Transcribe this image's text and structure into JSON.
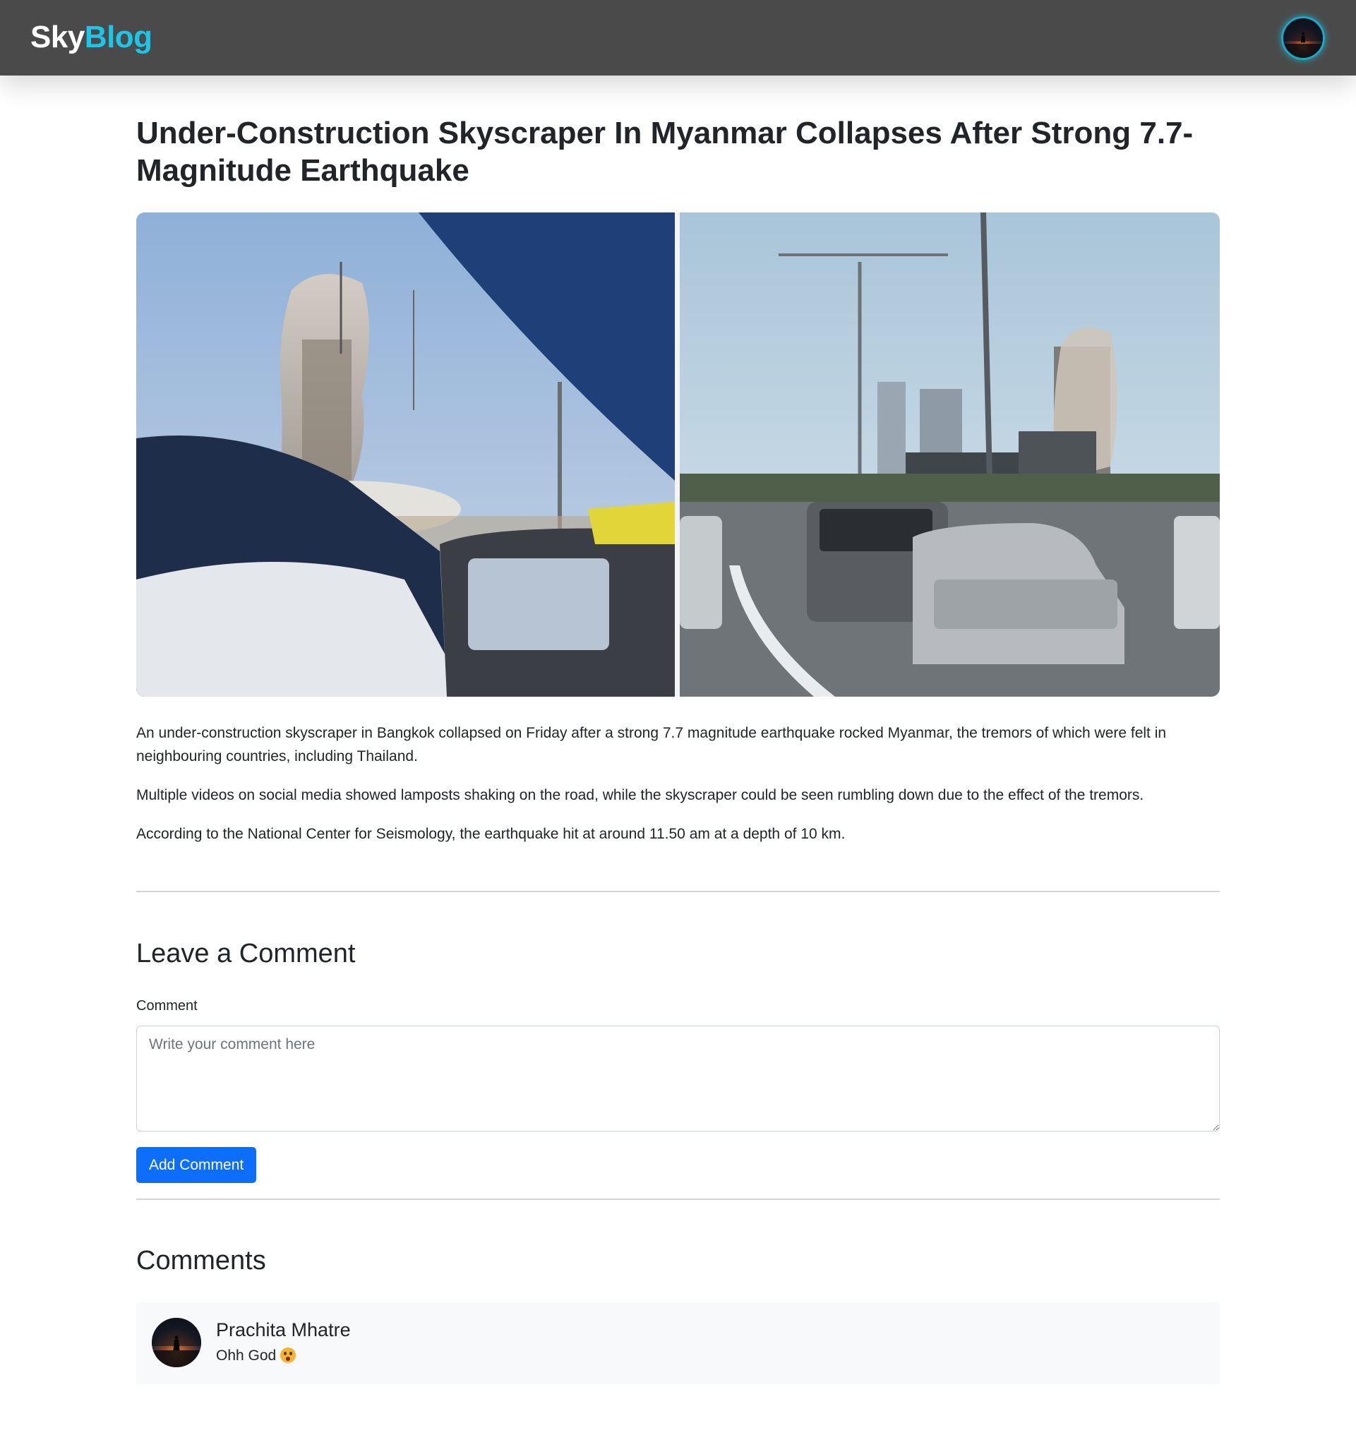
{
  "navbar": {
    "brand_part1": "Sky",
    "brand_part2": "Blog",
    "brand_accent": "#1cc6e8",
    "background": "#4a4a4a"
  },
  "article": {
    "title": "Under-Construction Skyscraper In Myanmar Collapses After Strong 7.7-Magnitude Earthquake",
    "paragraphs": [
      "An under-construction skyscraper in Bangkok collapsed on Friday after a strong 7.7 magnitude earthquake rocked Myanmar, the tremors of which were felt in neighbouring countries, including Thailand.",
      "Multiple videos on social media showed lamposts shaking on the road, while the skyscraper could be seen rumbling down due to the effect of the tremors.",
      "According to the National Center for Seismology, the earthquake hit at around 11.50 am at a depth of 10 km."
    ]
  },
  "comment_form": {
    "heading": "Leave a Comment",
    "label": "Comment",
    "placeholder": "Write your comment here",
    "value": "",
    "submit_label": "Add Comment",
    "button_color": "#0d6efd"
  },
  "comments": {
    "heading": "Comments",
    "items": [
      {
        "author": "Prachita Mhatre",
        "text": "Ohh God",
        "emoji_icon": "astonished-face-icon"
      }
    ]
  }
}
